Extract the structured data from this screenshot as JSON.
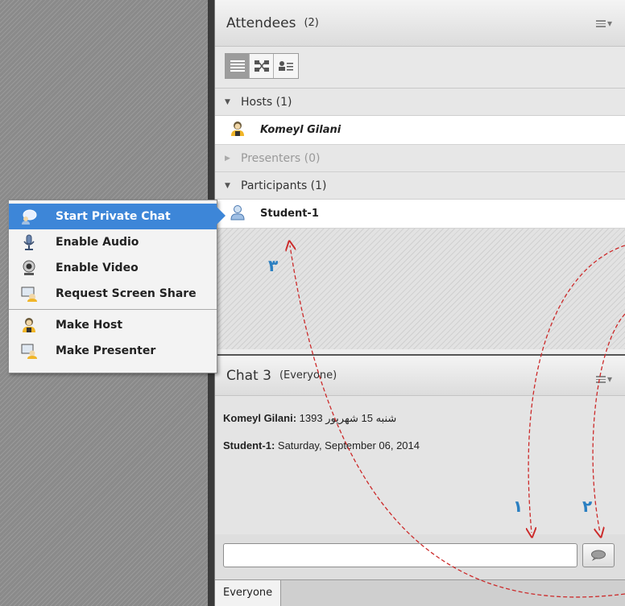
{
  "attendees": {
    "title": "Attendees",
    "count": "(2)",
    "menu_icon": "pod-options-icon",
    "view_buttons": [
      "list-view-icon",
      "breakout-view-icon",
      "role-view-icon"
    ],
    "groups": {
      "hosts": {
        "label": "Hosts (1)",
        "expanded": true
      },
      "presenters": {
        "label": "Presenters (0)",
        "expanded": false
      },
      "participants": {
        "label": "Participants (1)",
        "expanded": true
      }
    },
    "host_name": "Komeyl Gilani",
    "participant_name": "Student-1"
  },
  "context_menu": {
    "items": [
      {
        "label": "Start Private Chat",
        "icon": "private-chat-icon",
        "highlighted": true
      },
      {
        "label": "Enable Audio",
        "icon": "microphone-icon"
      },
      {
        "label": "Enable Video",
        "icon": "webcam-icon"
      },
      {
        "label": "Request Screen Share",
        "icon": "screen-share-icon"
      },
      {
        "label": "Make Host",
        "icon": "host-user-icon"
      },
      {
        "label": "Make Presenter",
        "icon": "presenter-icon"
      }
    ],
    "highlight_color": "#3d86d8"
  },
  "chat": {
    "title": "Chat 3",
    "scope": "(Everyone)",
    "messages": [
      {
        "sender": "Komeyl Gilani:",
        "text": " شنبه 15 شهریور 1393"
      },
      {
        "sender": "Student-1:",
        "text": " Saturday, September 06, 2014"
      }
    ],
    "input_value": "",
    "send_icon": "speech-bubble-icon",
    "tab_label": "Everyone"
  },
  "annotations": {
    "labels": [
      "۱",
      "۲",
      "۳"
    ],
    "arrow_color": "#cc2a2a",
    "label_color": "#2a7fc1"
  }
}
